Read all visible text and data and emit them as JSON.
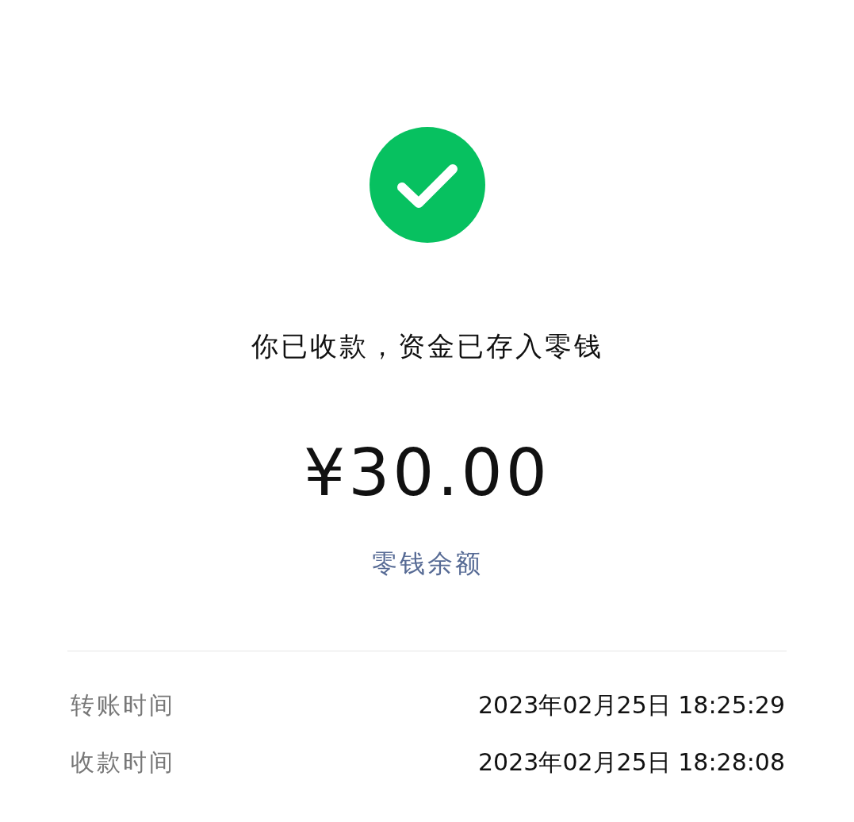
{
  "status": {
    "kind": "success"
  },
  "message": "你已收款，资金已存入零钱",
  "amount": "¥30.00",
  "balance_link": "零钱余额",
  "details": [
    {
      "label": "转账时间",
      "value": "2023年02月25日 18:25:29"
    },
    {
      "label": "收款时间",
      "value": "2023年02月25日 18:28:08"
    }
  ]
}
